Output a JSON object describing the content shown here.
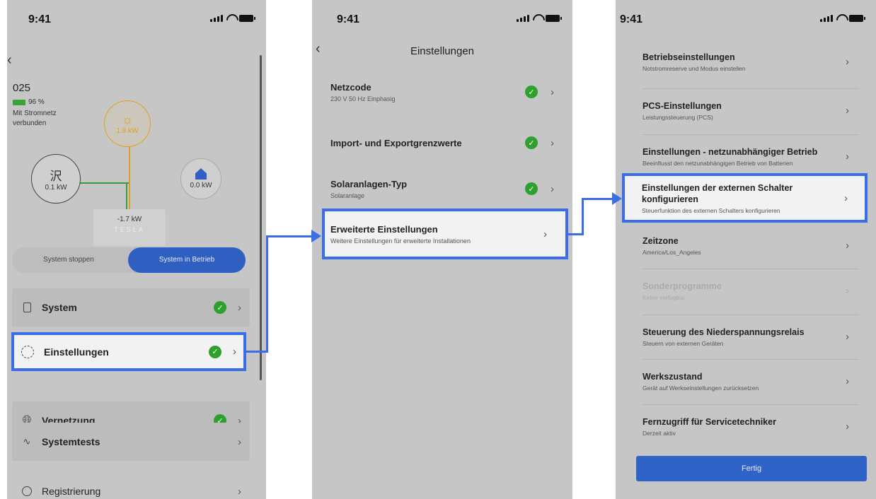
{
  "status": {
    "time": "9:41"
  },
  "screen1": {
    "id": "025",
    "battery": "96 %",
    "grid_status": "Mit Stromnetz verbunden",
    "solar_power": "1.8 kW",
    "grid_power": "0.1 kW",
    "home_power": "0.0 kW",
    "battery_power": "-1.7 kW",
    "brand": "TESLA",
    "toggle_off": "System stoppen",
    "toggle_on": "System in Betrieb",
    "menu": [
      {
        "label": "System",
        "icon": "system-icon",
        "check": true
      },
      {
        "label": "Einstellungen",
        "icon": "gear-icon",
        "check": true
      },
      {
        "label": "Vernetzung",
        "icon": "globe-icon",
        "check": true
      },
      {
        "label": "Systemtests",
        "icon": "pulse-icon",
        "check": false
      },
      {
        "label": "Registrierung",
        "icon": "user-icon",
        "check": false
      }
    ]
  },
  "screen2": {
    "title": "Einstellungen",
    "items": [
      {
        "title": "Netzcode",
        "subtitle": "230 V 50 Hz Einphasig"
      },
      {
        "title": "Import- und Exportgrenzwerte",
        "subtitle": ""
      },
      {
        "title": "Solaranlagen-Typ",
        "subtitle": "Solaranlage"
      },
      {
        "title": "Erweiterte Einstellungen",
        "subtitle": "Weitere Einstellungen für erweiterte Installationen"
      }
    ]
  },
  "screen3": {
    "items": [
      {
        "title": "Betriebseinstellungen",
        "subtitle": "Notstromreserve und Modus einstellen"
      },
      {
        "title": "PCS-Einstellungen",
        "subtitle": "Leistungssteuerung (PCS)"
      },
      {
        "title": "Einstellungen - netzunabhängiger Betrieb",
        "subtitle": "Beeinflusst den netzunabhängigen Betrieb von Batterien"
      },
      {
        "title": "Einstellungen der externen Schalter konfigurieren",
        "subtitle": "Steuerfunktion des externen Schalters konfigurieren"
      },
      {
        "title": "Zeitzone",
        "subtitle": "America/Los_Angeles"
      },
      {
        "title": "Sonderprogramme",
        "subtitle": "Keine verfügbar"
      },
      {
        "title": "Steuerung des Niederspannungsrelais",
        "subtitle": "Steuern von externen Geräten"
      },
      {
        "title": "Werkszustand",
        "subtitle": "Gerät auf Werkseinstellungen zurücksetzen"
      },
      {
        "title": "Fernzugriff für Servicetechniker",
        "subtitle": "Derzeit aktiv"
      }
    ],
    "done_label": "Fertig"
  },
  "colors": {
    "highlight": "#3a6ee8",
    "accent": "#2f5fc0",
    "check": "#2ea02e",
    "solar": "#e0a020"
  }
}
